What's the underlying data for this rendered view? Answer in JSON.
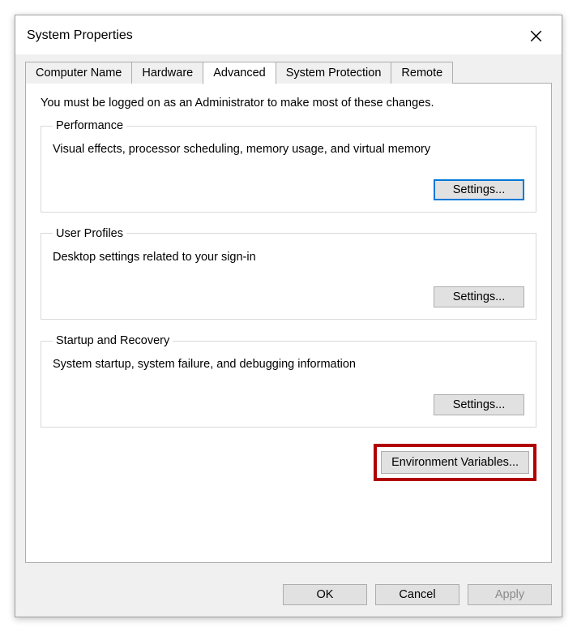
{
  "titlebar": {
    "title": "System Properties"
  },
  "tabs": [
    {
      "label": "Computer Name"
    },
    {
      "label": "Hardware"
    },
    {
      "label": "Advanced"
    },
    {
      "label": "System Protection"
    },
    {
      "label": "Remote"
    }
  ],
  "active_tab_index": 2,
  "advanced": {
    "intro": "You must be logged on as an Administrator to make most of these changes.",
    "performance": {
      "legend": "Performance",
      "desc": "Visual effects, processor scheduling, memory usage, and virtual memory",
      "button": "Settings..."
    },
    "user_profiles": {
      "legend": "User Profiles",
      "desc": "Desktop settings related to your sign-in",
      "button": "Settings..."
    },
    "startup_recovery": {
      "legend": "Startup and Recovery",
      "desc": "System startup, system failure, and debugging information",
      "button": "Settings..."
    },
    "env_button": "Environment Variables..."
  },
  "buttons": {
    "ok": "OK",
    "cancel": "Cancel",
    "apply": "Apply"
  }
}
